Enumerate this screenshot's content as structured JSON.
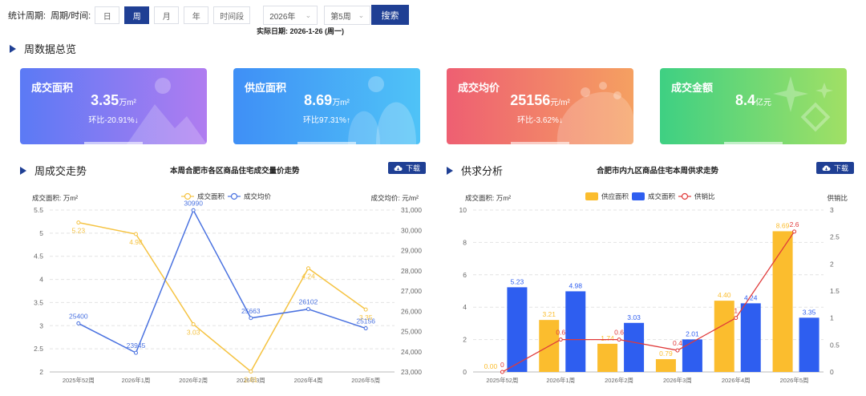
{
  "filters": {
    "period_label": "统计周期:",
    "period_time_label": "周期/时间:",
    "period_buttons": [
      "日",
      "周",
      "月",
      "年",
      "时间段"
    ],
    "active_period": "周",
    "year_value": "2026年",
    "week_value": "第5周",
    "search_label": "搜索",
    "actual_date": "实际日期: 2026-1-26 (周一)"
  },
  "overview": {
    "title": "周数据总览",
    "cards": [
      {
        "name": "成交面积",
        "value": "3.35",
        "unit": "万m²",
        "change": "环比-20.91%↓",
        "color_from": "#5b7af5",
        "color_to": "#b07cf0"
      },
      {
        "name": "供应面积",
        "value": "8.69",
        "unit": "万m²",
        "change": "环比97.31%↑",
        "color_from": "#3f8ff6",
        "color_to": "#4fc3f7"
      },
      {
        "name": "成交均价",
        "value": "25156",
        "unit": "元/m²",
        "change": "环比-3.62%↓",
        "color_from": "#ee5f72",
        "color_to": "#f5a061"
      },
      {
        "name": "成交金额",
        "value": "8.4",
        "unit": "亿元",
        "change": "",
        "color_from": "#3ed083",
        "color_to": "#a1e065"
      }
    ]
  },
  "left_section": {
    "title": "周成交走势",
    "chart_title": "本周合肥市各区商品住宅成交量价走势",
    "download_label": "下载"
  },
  "right_section": {
    "title": "供求分析",
    "chart_title": "合肥市内九区商品住宅本周供求走势",
    "download_label": "下载"
  },
  "chart_data": [
    {
      "type": "line",
      "x": [
        "2025年52周",
        "2026年1周",
        "2026年2周",
        "2026年3周",
        "2026年4周",
        "2026年5周"
      ],
      "ylabel_left": "成交面积: 万m²",
      "ylabel_right": "成交均价: 元/m²",
      "ylim_left": [
        2,
        5.5
      ],
      "ylim_right": [
        23000,
        31000
      ],
      "yticks_left": [
        "2",
        "2.5",
        "3",
        "3.5",
        "4",
        "4.5",
        "5",
        "5.5"
      ],
      "yticks_right": [
        "23,000",
        "24,000",
        "25,000",
        "26,000",
        "27,000",
        "28,000",
        "29,000",
        "30,000",
        "31,000"
      ],
      "legend_position": "top-center",
      "grid": true,
      "series": [
        {
          "name": "成交面积",
          "axis": "left",
          "color": "#f5c342",
          "values": [
            5.23,
            4.98,
            3.03,
            2.01,
            4.24,
            3.35
          ],
          "labels": [
            "5.23",
            "4.98",
            "3.03",
            "2.01",
            "4.24",
            "3.35"
          ]
        },
        {
          "name": "成交均价",
          "axis": "right",
          "color": "#4a72e0",
          "values": [
            25400,
            23945,
            30990,
            25663,
            26102,
            25156
          ],
          "labels": [
            "25400",
            "23945",
            "30990",
            "25663",
            "26102",
            "25156"
          ]
        }
      ]
    },
    {
      "type": "bar",
      "x": [
        "2025年52周",
        "2026年1周",
        "2026年2周",
        "2026年3周",
        "2026年4周",
        "2026年5周"
      ],
      "ylabel_left": "成交面积: 万m²",
      "ylabel_right": "供销比",
      "ylim_left": [
        0,
        10
      ],
      "ylim_right": [
        0,
        3
      ],
      "yticks_left": [
        "0",
        "2",
        "4",
        "6",
        "8",
        "10"
      ],
      "yticks_right": [
        "0",
        "0.5",
        "1",
        "1.5",
        "2",
        "2.5",
        "3"
      ],
      "legend_position": "top-center",
      "grid": true,
      "series": [
        {
          "name": "供应面积",
          "axis": "left",
          "kind": "bar",
          "color": "#fbbd2e",
          "values": [
            0,
            3.21,
            1.74,
            0.79,
            4.4,
            8.69
          ],
          "labels": [
            "0.00",
            "3.21",
            "1.74",
            "0.79",
            "4.40",
            "8.69"
          ]
        },
        {
          "name": "成交面积",
          "axis": "left",
          "kind": "bar",
          "color": "#2e5ef0",
          "values": [
            5.23,
            4.98,
            3.03,
            2.01,
            4.24,
            3.35
          ],
          "labels": [
            "5.23",
            "4.98",
            "3.03",
            "2.01",
            "4.24",
            "3.35"
          ]
        },
        {
          "name": "供销比",
          "axis": "right",
          "kind": "line",
          "color": "#e03a3a",
          "values": [
            0,
            0.6,
            0.6,
            0.4,
            1,
            2.6
          ],
          "labels": [
            "0",
            "0.6",
            "0.6",
            "0.4",
            "1",
            "2.6"
          ]
        }
      ]
    }
  ]
}
